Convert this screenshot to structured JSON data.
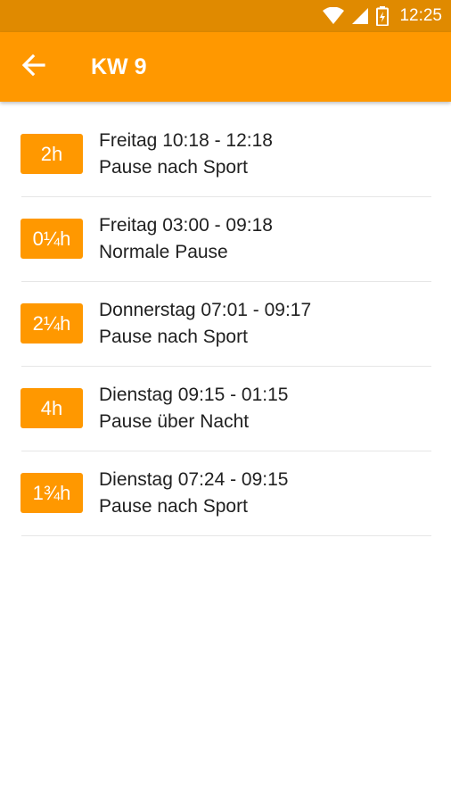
{
  "status_bar": {
    "time": "12:25",
    "icons": [
      "wifi-icon",
      "cell-signal-icon",
      "battery-icon"
    ]
  },
  "app_bar": {
    "back_icon": "arrow-left-icon",
    "title": "KW 9"
  },
  "colors": {
    "primary": "#ff9800",
    "primary_dark": "#e08a00",
    "text": "#212121",
    "divider": "#e6e6e6"
  },
  "breaks": [
    {
      "duration": "2h",
      "time": "Freitag 10:18 - 12:18",
      "type": "Pause nach Sport"
    },
    {
      "duration": "0¼h",
      "time": "Freitag 03:00 - 09:18",
      "type": "Normale Pause"
    },
    {
      "duration": "2¼h",
      "time": "Donnerstag 07:01 - 09:17",
      "type": "Pause nach Sport"
    },
    {
      "duration": "4h",
      "time": "Dienstag 09:15 - 01:15",
      "type": "Pause über Nacht"
    },
    {
      "duration": "1¾h",
      "time": "Dienstag 07:24 - 09:15",
      "type": "Pause nach Sport"
    }
  ]
}
